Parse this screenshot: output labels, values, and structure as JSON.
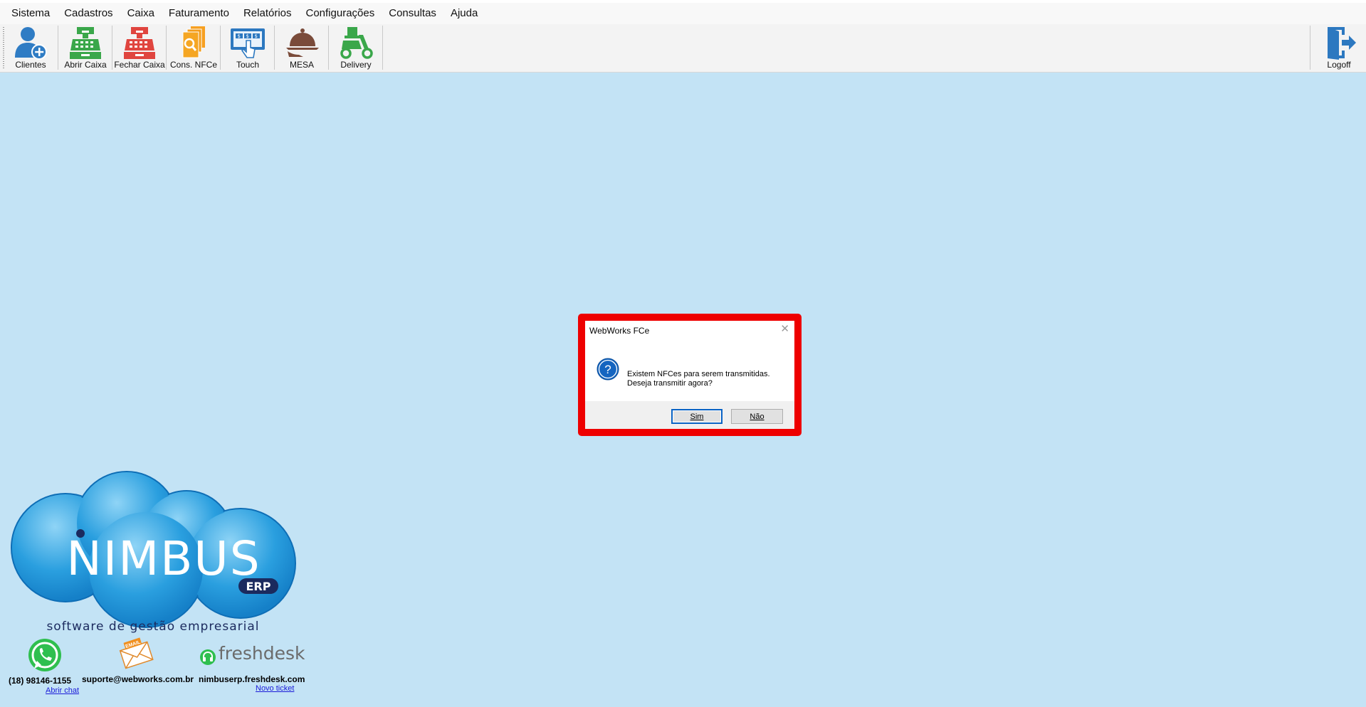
{
  "menu": [
    "Sistema",
    "Cadastros",
    "Caixa",
    "Faturamento",
    "Relatórios",
    "Configurações",
    "Consultas",
    "Ajuda"
  ],
  "toolbar": {
    "clientes": "Clientes",
    "abrir_caixa": "Abrir Caixa",
    "fechar_caixa": "Fechar Caixa",
    "cons_nfce": "Cons. NFCe",
    "touch": "Touch",
    "mesa": "MESA",
    "delivery": "Delivery",
    "logoff": "Logoff"
  },
  "dialog": {
    "title": "WebWorks FCe",
    "close": "✕",
    "icon": "question-icon",
    "message_line1": "Existem NFCes para serem transmitidas.",
    "message_line2": "Deseja transmitir agora?",
    "yes": "Sim",
    "no": "Não",
    "highlight_color": "#ee0000"
  },
  "brand": {
    "logo_text": "NIMBUS",
    "logo_sub": "ERP",
    "tagline": "software de gestão empresarial",
    "phone": "(18) 98146-1155",
    "phone_link": "Abrir chat",
    "email_badge": "EMAIL",
    "email": "suporte@webworks.com.br",
    "freshdesk_label": "freshdesk",
    "freshdesk_url": "nimbuserp.freshdesk.com",
    "freshdesk_link": "Novo ticket"
  },
  "colors": {
    "background": "#c3e3f5",
    "accent_blue": "#2c78c0",
    "green": "#3aa74a",
    "red": "#e0453f"
  }
}
